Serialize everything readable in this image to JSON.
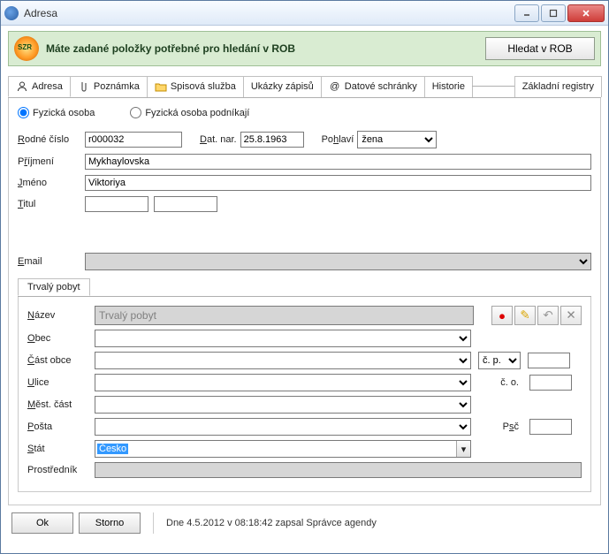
{
  "window": {
    "title": "Adresa"
  },
  "banner": {
    "message": "Máte zadané položky potřebné pro hledání v ROB",
    "button": "Hledat v ROB"
  },
  "tabs": {
    "adresa": "Adresa",
    "poznamka": "Poznámka",
    "spisova": "Spisová služba",
    "ukazky": "Ukázky zápisů",
    "datove": "Datové schránky",
    "historie": "Historie",
    "registry": "Základní registry"
  },
  "radio": {
    "fyzicka": "Fyzická osoba",
    "podnikaji": "Fyzická osoba podníkají"
  },
  "form": {
    "rodne_label_pre": "R",
    "rodne_label_rest": "odné číslo",
    "rodne_value": "r000032",
    "datnar_label": "Dat. nar.",
    "datnar_value": "25.8.1963",
    "pohlavi_label_pre": "Po",
    "pohlavi_label_u": "h",
    "pohlavi_label_rest": "laví",
    "pohlavi_value": "žena",
    "prijmeni_label_pre": "P",
    "prijmeni_label_u": "ř",
    "prijmeni_label_rest": "íjmení",
    "prijmeni_value": "Mykhaylovska",
    "jmeno_label_u": "J",
    "jmeno_label_rest": "méno",
    "jmeno_value": "Viktoriya",
    "titul_label_u": "T",
    "titul_label_rest": "itul",
    "email_label_u": "E",
    "email_label_rest": "mail"
  },
  "subtabs": {
    "trvaly": "Trvalý pobyt"
  },
  "address": {
    "nazev_label_u": "N",
    "nazev_label_rest": "ázev",
    "nazev_value": "Trvalý pobyt",
    "obec_label_u": "O",
    "obec_label_rest": "bec",
    "cast_label_u": "Č",
    "cast_label_rest": "ást obce",
    "cp_label": "č. p.",
    "ulice_label_u": "U",
    "ulice_label_rest": "lice",
    "co_label": "č. o.",
    "mest_label_u": "M",
    "mest_label_rest": "ěst. část",
    "posta_label_u": "P",
    "posta_label_rest": "ošta",
    "psc_label_pre": "P",
    "psc_label_u": "s",
    "psc_label_rest": "č",
    "stat_label_u": "S",
    "stat_label_rest": "tát",
    "stat_value": "Česko",
    "prostrednik_label": "Prostředník"
  },
  "footer": {
    "ok": "Ok",
    "storno": "Storno",
    "status": "Dne 4.5.2012 v 08:18:42 zapsal Správce agendy"
  }
}
